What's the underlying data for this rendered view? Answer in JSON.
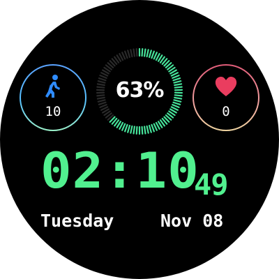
{
  "watch_face": {
    "steps": {
      "icon": "walking-person-icon",
      "value": "10",
      "ring_colors": [
        "#5aa2ff",
        "#59c3ff",
        "#9cf0c8"
      ],
      "icon_color": "#2f8cff"
    },
    "battery": {
      "label": "63%",
      "percent": 63,
      "active_color": "#46e39a",
      "inactive_color": "#2a2a2a"
    },
    "heart_rate": {
      "icon": "heart-icon",
      "value": "0",
      "ring_colors": [
        "#e05b78",
        "#f2a0a0",
        "#eed4a0"
      ],
      "icon_color": "#ea3d5f"
    },
    "time": {
      "hours_minutes": "02:10",
      "seconds": "49",
      "color": "#51f08f"
    },
    "date": {
      "weekday": "Tuesday",
      "month_day": "Nov 08"
    }
  }
}
